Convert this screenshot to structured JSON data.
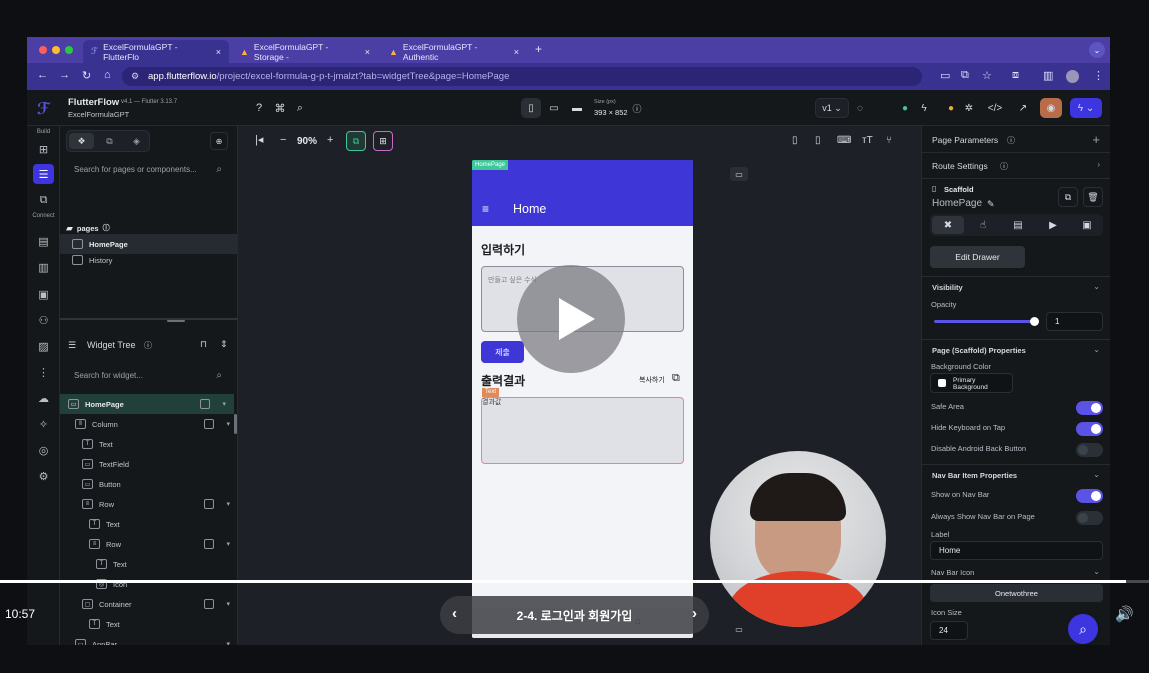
{
  "browser": {
    "tabs": [
      {
        "label": "ExcelFormulaGPT - FlutterFlo",
        "icon": "flutterflow-icon"
      },
      {
        "label": "ExcelFormulaGPT - Storage -",
        "icon": "firebase-icon"
      },
      {
        "label": "ExcelFormulaGPT - Authentic",
        "icon": "firebase-icon"
      }
    ],
    "new_tab": "+",
    "url_host": "app.flutterflow.io",
    "url_path": "/project/excel-formula-g-p-t-jmalzt?tab=widgetTree&page=HomePage"
  },
  "toolbar": {
    "app_name": "FlutterFlow",
    "version": "v4.1 — Flutter 3.13.7",
    "project_name": "ExcelFormulaGPT",
    "size_label": "Size (px)",
    "size_value": "393 × 852",
    "zoom": "90%",
    "version_select": "v1"
  },
  "rail": {
    "build_label": "Build",
    "connect_label": "Connect"
  },
  "left_panel": {
    "search_pages_placeholder": "Search for pages or components...",
    "pages_label": "pages",
    "pages": [
      "HomePage",
      "History"
    ],
    "widget_tree_title": "Widget Tree",
    "search_widget_placeholder": "Search for widget...",
    "tree": [
      {
        "label": "HomePage",
        "indent": 0,
        "selected": true
      },
      {
        "label": "Column",
        "indent": 1
      },
      {
        "label": "Text",
        "indent": 2
      },
      {
        "label": "TextField",
        "indent": 2
      },
      {
        "label": "Button",
        "indent": 2
      },
      {
        "label": "Row",
        "indent": 2
      },
      {
        "label": "Text",
        "indent": 3
      },
      {
        "label": "Row",
        "indent": 3
      },
      {
        "label": "Text",
        "indent": 4
      },
      {
        "label": "Icon",
        "indent": 4
      },
      {
        "label": "Container",
        "indent": 2
      },
      {
        "label": "Text",
        "indent": 3
      },
      {
        "label": "AppBar",
        "indent": 1
      },
      {
        "label": "Text",
        "indent": 2
      }
    ]
  },
  "phone": {
    "page_tag": "HomePage",
    "app_title": "Home",
    "input_heading": "입력하기",
    "input_placeholder": "만들고 싶은 수식",
    "submit_label": "제출",
    "output_heading": "출력결과",
    "copy_label": "복사하기",
    "text_tag": "Text",
    "output_value": "결과값"
  },
  "right_panel": {
    "page_parameters": "Page Parameters",
    "route_settings": "Route Settings",
    "widget_type": "Scaffold",
    "widget_name": "HomePage",
    "edit_drawer": "Edit Drawer",
    "visibility": "Visibility",
    "opacity_label": "Opacity",
    "opacity_value": "1",
    "scaffold_props": "Page (Scaffold) Properties",
    "bg_color_label": "Background Color",
    "bg_color_value": "Primary Background",
    "safe_area": "Safe Area",
    "hide_keyboard": "Hide Keyboard on Tap",
    "disable_back": "Disable Android Back Button",
    "nav_bar_props": "Nav Bar Item Properties",
    "show_nav": "Show on Nav Bar",
    "always_show_nav": "Always Show Nav Bar on Page",
    "label_label": "Label",
    "label_value": "Home",
    "nav_icon_label": "Nav Bar Icon",
    "icon_button": "Onetwothree",
    "icon_size_label": "Icon Size",
    "icon_size_value": "24"
  },
  "video": {
    "time": "10:57",
    "chapter": "2-4. 로그인과 회원가입",
    "progress": 0.98
  }
}
